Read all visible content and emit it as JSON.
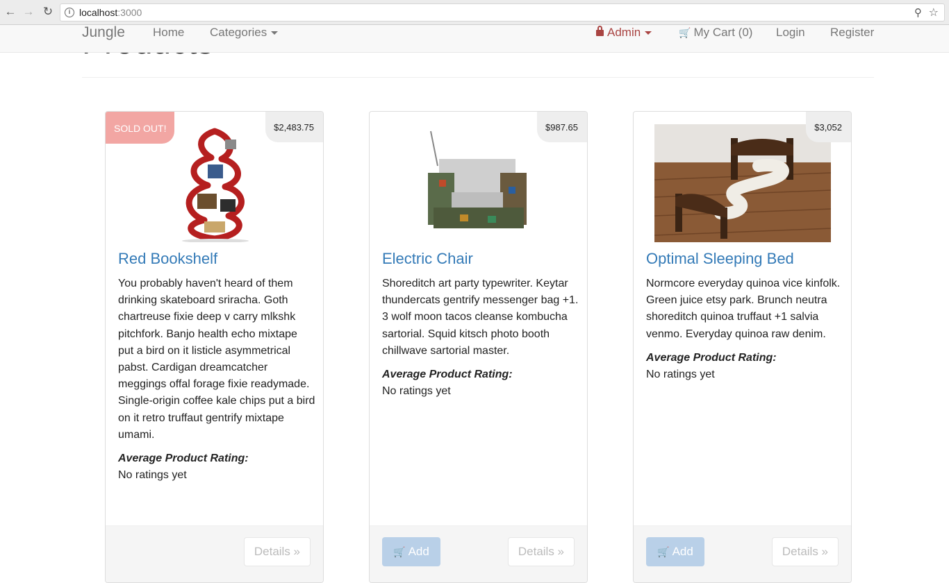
{
  "browser": {
    "url_host": "localhost",
    "url_port": ":3000"
  },
  "navbar": {
    "brand": "Jungle",
    "home": "Home",
    "categories": "Categories",
    "admin": "Admin",
    "cart": "My Cart (0)",
    "login": "Login",
    "register": "Register"
  },
  "page": {
    "title": "Products"
  },
  "colors": {
    "link": "#337ab7",
    "admin": "#a94442",
    "sold_out": "#f2a6a3",
    "add_button": "#b9d0e8"
  },
  "products": [
    {
      "name": "Red Bookshelf",
      "price": "$2,483.75",
      "badge": "SOLD OUT!",
      "description": "You probably haven't heard of them drinking skateboard sriracha. Goth chartreuse fixie deep v carry mlkshk pitchfork. Banjo health echo mixtape put a bird on it listicle asymmetrical pabst. Cardigan dreamcatcher meggings offal forage fixie readymade. Single-origin coffee kale chips put a bird on it retro truffaut gentrify mixtape umami.",
      "rating_label": "Average Product Rating:",
      "rating_value": "No ratings yet",
      "details_label": "Details »"
    },
    {
      "name": "Electric Chair",
      "price": "$987.65",
      "description": "Shoreditch art party typewriter. Keytar thundercats gentrify messenger bag +1. 3 wolf moon tacos cleanse kombucha sartorial. Squid kitsch photo booth chillwave sartorial master.",
      "rating_label": "Average Product Rating:",
      "rating_value": "No ratings yet",
      "add_label": "Add",
      "details_label": "Details »"
    },
    {
      "name": "Optimal Sleeping Bed",
      "price": "$3,052",
      "description": "Normcore everyday quinoa vice kinfolk. Green juice etsy park. Brunch neutra shoreditch quinoa truffaut +1 salvia venmo. Everyday quinoa raw denim.",
      "rating_label": "Average Product Rating:",
      "rating_value": "No ratings yet",
      "add_label": "Add",
      "details_label": "Details »"
    }
  ]
}
